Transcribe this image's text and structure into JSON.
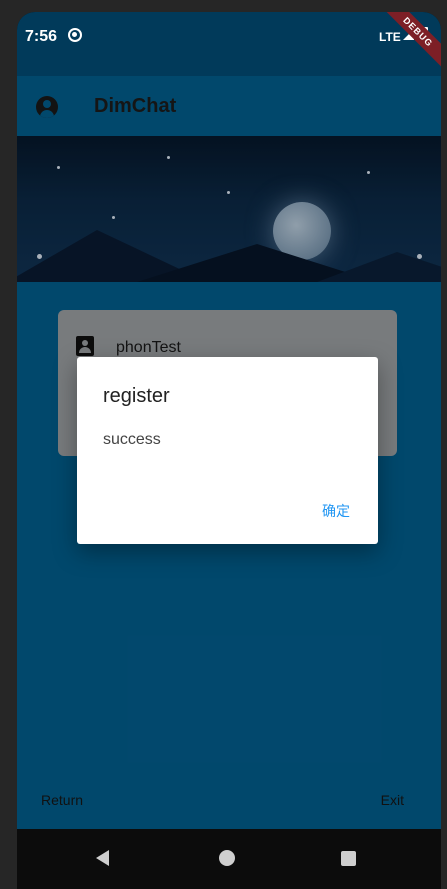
{
  "status_bar": {
    "time": "7:56",
    "network": "LTE",
    "debug_label": "DEBUG"
  },
  "app_bar": {
    "title": "DimChat",
    "account_icon": "account-circle-icon"
  },
  "profile": {
    "username": "phonTest",
    "icon": "contact-card-icon"
  },
  "bottom_bar": {
    "return_label": "Return",
    "exit_label": "Exit"
  },
  "dialog": {
    "title": "register",
    "content": "success",
    "confirm_label": "确定"
  },
  "colors": {
    "primary": "#025f8f",
    "status_bar": "#013a5a",
    "accent": "#2196f3"
  }
}
